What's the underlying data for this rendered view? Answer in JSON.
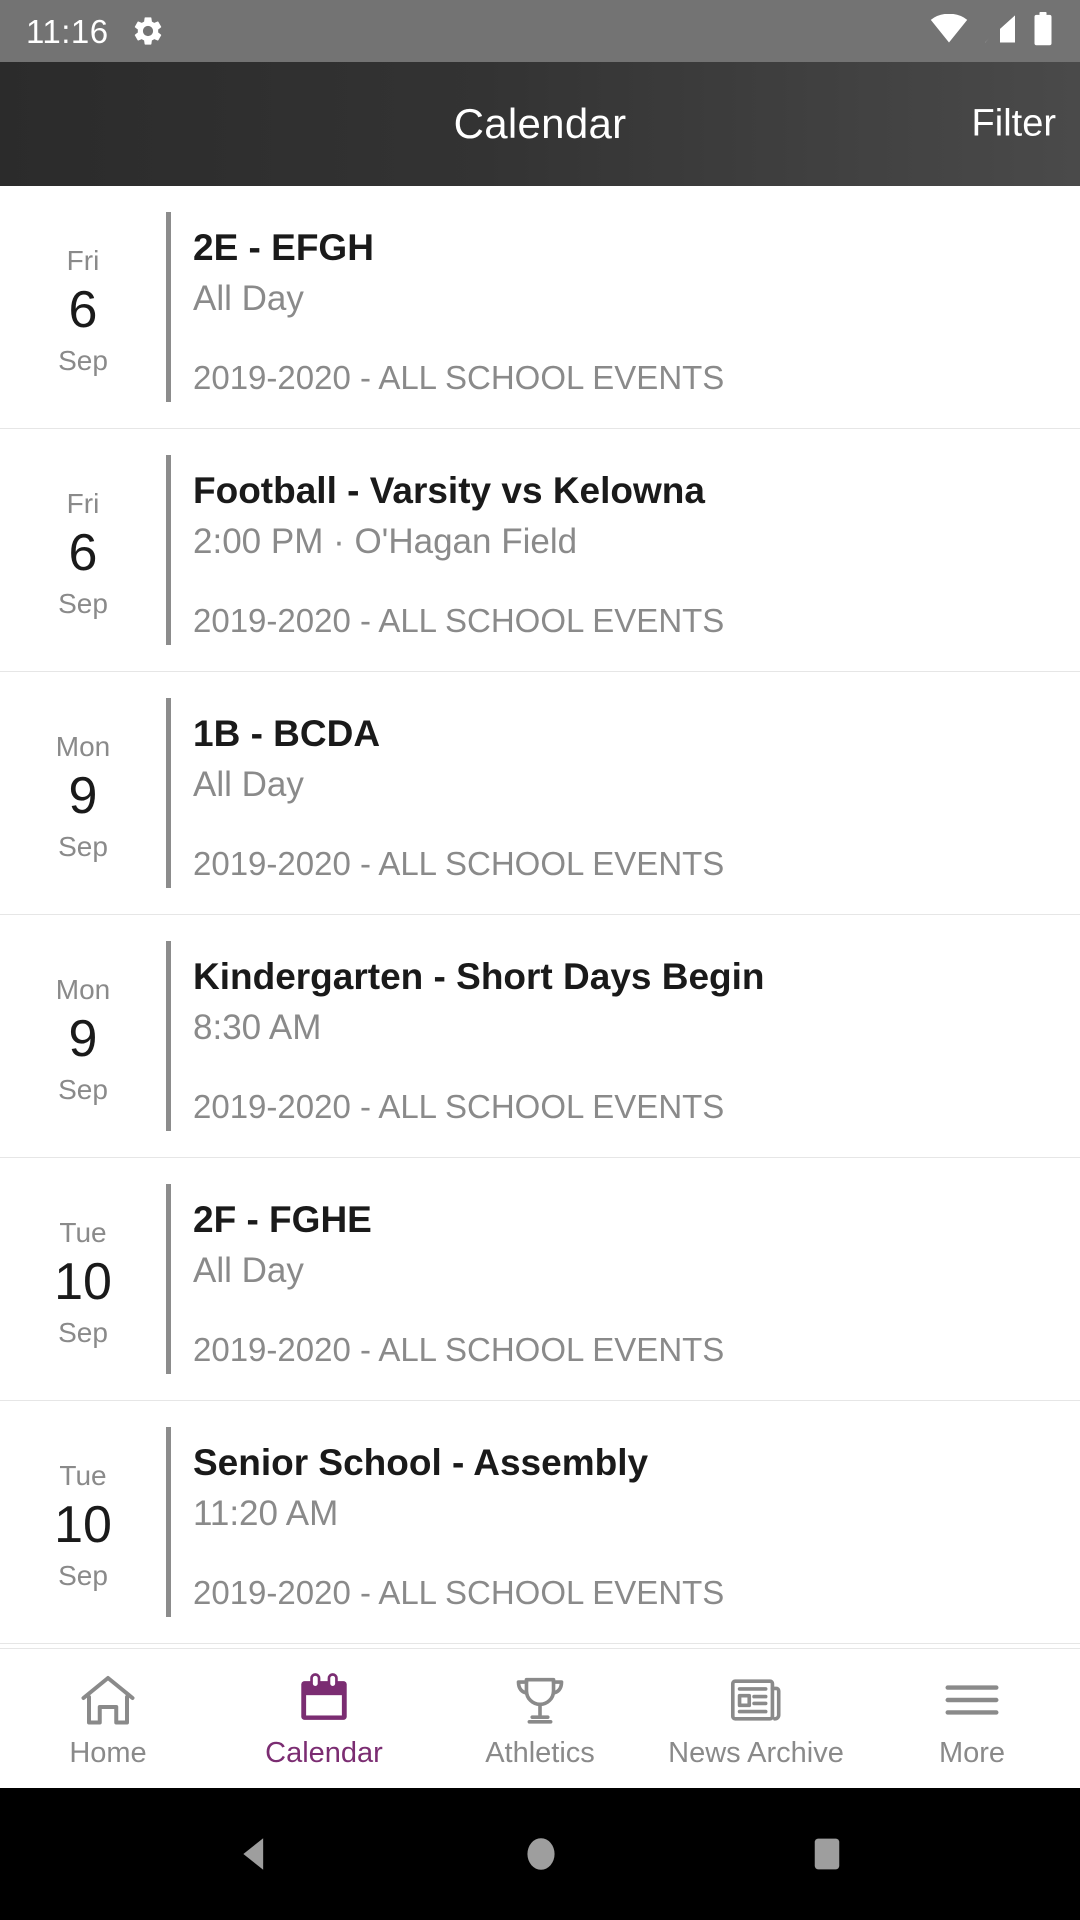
{
  "status_bar": {
    "time": "11:16",
    "gear_icon": "gear-icon",
    "wifi_icon": "wifi-icon",
    "signal_icon": "cell-signal-icon",
    "battery_icon": "battery-full-icon",
    "background": "#737373"
  },
  "header": {
    "title": "Calendar",
    "action_label": "Filter",
    "background": "#333333"
  },
  "events": [
    {
      "dow": "Fri",
      "day": "6",
      "month": "Sep",
      "title": "2E - EFGH",
      "subtitle": "All Day",
      "category": "2019-2020 - ALL SCHOOL EVENTS"
    },
    {
      "dow": "Fri",
      "day": "6",
      "month": "Sep",
      "title": "Football - Varsity vs Kelowna",
      "subtitle": "2:00 PM · O'Hagan Field",
      "category": "2019-2020 - ALL SCHOOL EVENTS"
    },
    {
      "dow": "Mon",
      "day": "9",
      "month": "Sep",
      "title": "1B - BCDA",
      "subtitle": "All Day",
      "category": "2019-2020 - ALL SCHOOL EVENTS"
    },
    {
      "dow": "Mon",
      "day": "9",
      "month": "Sep",
      "title": "Kindergarten - Short Days Begin",
      "subtitle": "8:30 AM",
      "category": "2019-2020 - ALL SCHOOL EVENTS"
    },
    {
      "dow": "Tue",
      "day": "10",
      "month": "Sep",
      "title": "2F - FGHE",
      "subtitle": "All Day",
      "category": "2019-2020 - ALL SCHOOL EVENTS"
    },
    {
      "dow": "Tue",
      "day": "10",
      "month": "Sep",
      "title": "Senior School - Assembly",
      "subtitle": "11:20 AM",
      "category": "2019-2020 - ALL SCHOOL EVENTS"
    }
  ],
  "tabs": [
    {
      "label": "Home",
      "icon": "home-icon",
      "active": false
    },
    {
      "label": "Calendar",
      "icon": "calendar-icon",
      "active": true
    },
    {
      "label": "Athletics",
      "icon": "trophy-icon",
      "active": false
    },
    {
      "label": "News Archive",
      "icon": "newspaper-icon",
      "active": false
    },
    {
      "label": "More",
      "icon": "hamburger-menu-icon",
      "active": false
    }
  ],
  "colors": {
    "accent": "#7b2d72",
    "inactive": "#8a8a8a",
    "text_primary": "#1a1a1a",
    "text_secondary": "#8a8a8a",
    "divider": "#e6e6e6"
  },
  "android_nav": {
    "back_icon": "back-triangle-icon",
    "home_icon": "home-circle-icon",
    "recents_icon": "recents-square-icon"
  }
}
